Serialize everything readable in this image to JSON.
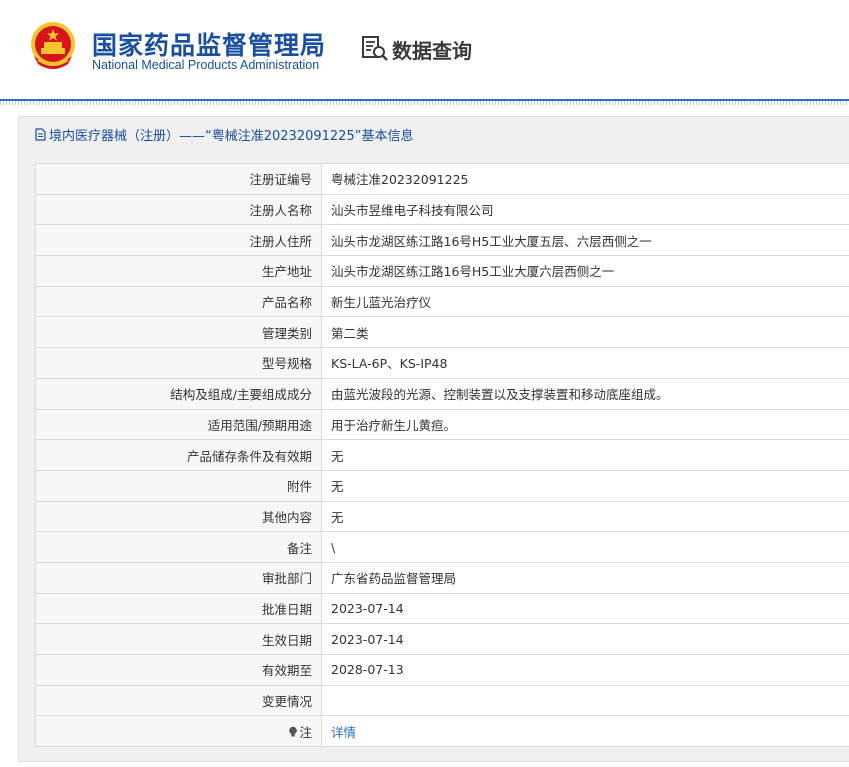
{
  "header": {
    "title_cn": "国家药品监督管理局",
    "title_en": "National Medical Products Administration",
    "query_label": "数据查询"
  },
  "panel": {
    "title": "境内医疗器械（注册）——“粤械注准20232091225”基本信息"
  },
  "rows": [
    {
      "key": "注册证编号",
      "value": "粤械注准20232091225"
    },
    {
      "key": "注册人名称",
      "value": "汕头市昱维电子科技有限公司"
    },
    {
      "key": "注册人住所",
      "value": "汕头市龙湖区练江路16号H5工业大厦五层、六层西侧之一"
    },
    {
      "key": "生产地址",
      "value": "汕头市龙湖区练江路16号H5工业大厦六层西侧之一"
    },
    {
      "key": "产品名称",
      "value": "新生儿蓝光治疗仪"
    },
    {
      "key": "管理类别",
      "value": "第二类"
    },
    {
      "key": "型号规格",
      "value": "KS-LA-6P、KS-IP48"
    },
    {
      "key": "结构及组成/主要组成成分",
      "value": "由蓝光波段的光源、控制装置以及支撑装置和移动底座组成。"
    },
    {
      "key": "适用范围/预期用途",
      "value": "用于治疗新生儿黄疸。"
    },
    {
      "key": "产品储存条件及有效期",
      "value": "无"
    },
    {
      "key": "附件",
      "value": "无"
    },
    {
      "key": "其他内容",
      "value": "无"
    },
    {
      "key": "备注",
      "value": "\\"
    },
    {
      "key": "审批部门",
      "value": "广东省药品监督管理局"
    },
    {
      "key": "批准日期",
      "value": "2023-07-14"
    },
    {
      "key": "生效日期",
      "value": "2023-07-14"
    },
    {
      "key": "有效期至",
      "value": "2028-07-13"
    },
    {
      "key": "变更情况",
      "value": ""
    }
  ],
  "note_row": {
    "key": "注",
    "value": "详情"
  },
  "colors": {
    "brand_blue": "#1a4fa0",
    "link_blue": "#2a6ebc",
    "emblem_red": "#d7141a",
    "emblem_gold": "#f4c430"
  },
  "icons": {
    "emblem": "national-emblem-icon",
    "query": "search-document-icon",
    "panel": "document-icon",
    "note": "lightbulb-icon"
  }
}
